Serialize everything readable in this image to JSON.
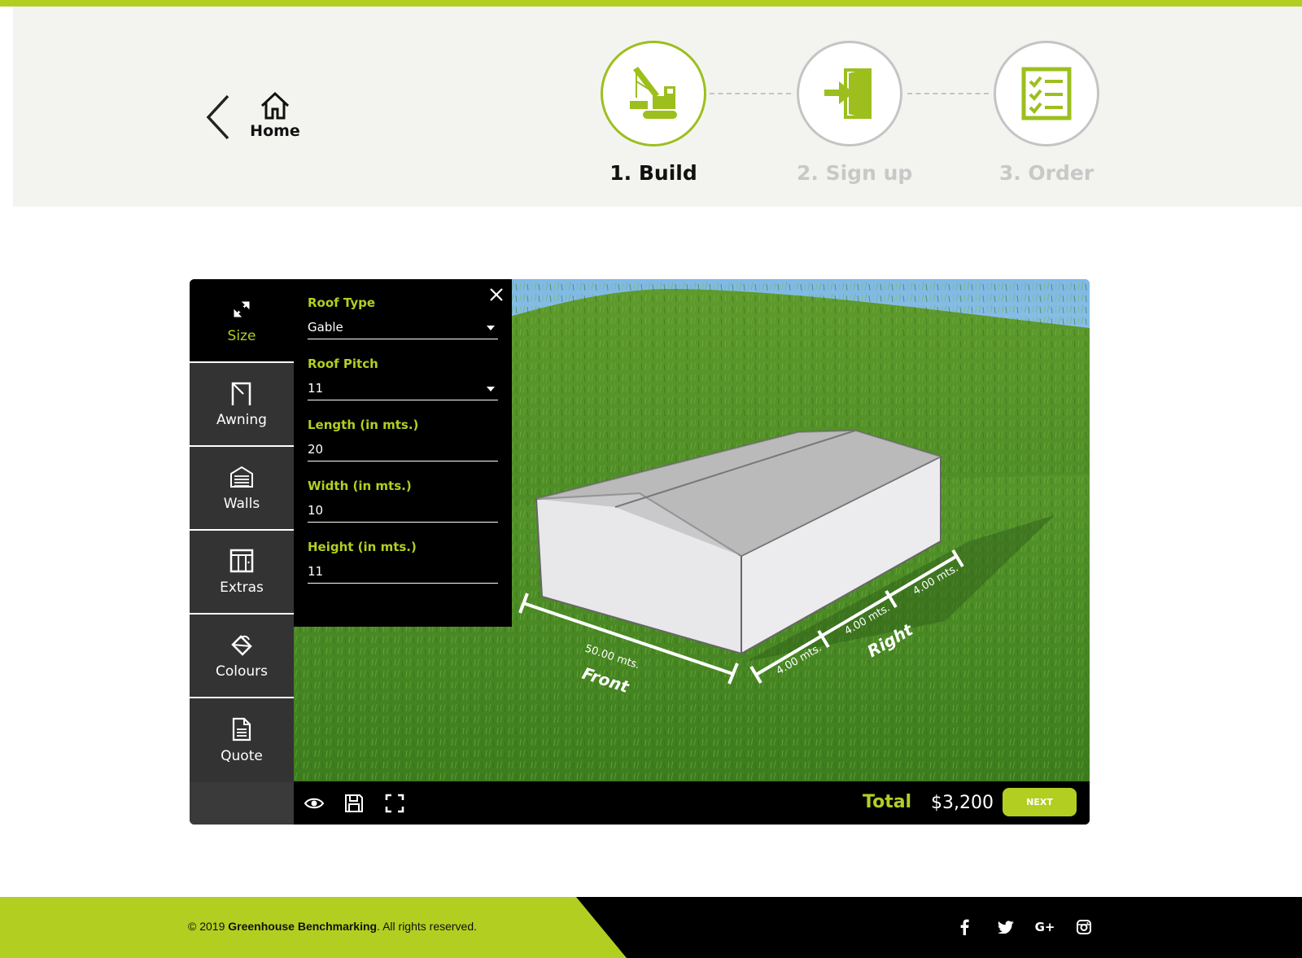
{
  "brand": {
    "accent": "#b2cf21",
    "dark": "#000000"
  },
  "nav": {
    "home_label": "Home"
  },
  "steps": [
    {
      "label": "1. Build",
      "state": "active",
      "icon": "crane-icon"
    },
    {
      "label": "2. Sign up",
      "state": "inactive",
      "icon": "sign-in-door-icon"
    },
    {
      "label": "3. Order",
      "state": "inactive",
      "icon": "checklist-icon"
    }
  ],
  "sidebar": {
    "items": [
      {
        "label": "Size",
        "icon": "resize-arrows-icon",
        "active": true
      },
      {
        "label": "Awning",
        "icon": "awning-icon",
        "active": false
      },
      {
        "label": "Walls",
        "icon": "garage-door-icon",
        "active": false
      },
      {
        "label": "Extras",
        "icon": "window-icon",
        "active": false
      },
      {
        "label": "Colours",
        "icon": "paint-bucket-icon",
        "active": false
      },
      {
        "label": "Quote",
        "icon": "document-icon",
        "active": false
      }
    ]
  },
  "panel": {
    "roof_type": {
      "label": "Roof Type",
      "value": "Gable"
    },
    "roof_pitch": {
      "label": "Roof Pitch",
      "value": "11"
    },
    "length": {
      "label": "Length (in mts.)",
      "value": "20"
    },
    "width": {
      "label": "Width (in mts.)",
      "value": "10"
    },
    "height": {
      "label": "Height (in mts.)",
      "value": "11"
    }
  },
  "scene": {
    "front_dim": "50.00 mts.",
    "front_label": "Front",
    "right_dims": [
      "4.00 mts.",
      "4.00 mts.",
      "4.00 mts."
    ],
    "right_label": "Right"
  },
  "toolbar": {
    "icons": [
      "eye-icon",
      "save-icon",
      "fullscreen-icon"
    ]
  },
  "totals": {
    "label": "Total",
    "value": "$3,200",
    "next_label": "NEXT"
  },
  "footer": {
    "copyright_prefix": "© 2019 ",
    "company": "Greenhouse Benchmarking",
    "copyright_suffix": ". All rights reserved.",
    "social": [
      "facebook-icon",
      "twitter-icon",
      "google-plus-icon",
      "instagram-icon"
    ]
  }
}
